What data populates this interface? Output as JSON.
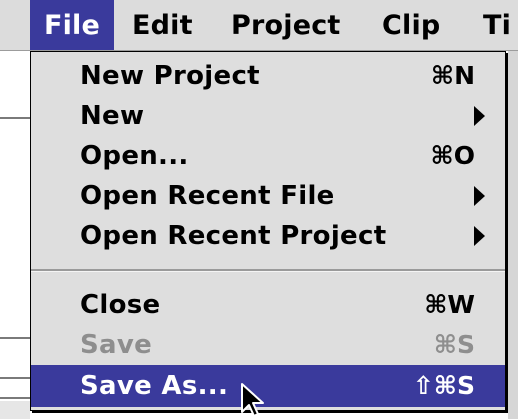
{
  "menubar": {
    "items": [
      {
        "label": "File",
        "open": true
      },
      {
        "label": "Edit"
      },
      {
        "label": "Project"
      },
      {
        "label": "Clip"
      },
      {
        "label": "Ti"
      }
    ]
  },
  "file_menu": {
    "items": [
      {
        "label": "New Project",
        "shortcut": "⌘N"
      },
      {
        "label": "New",
        "submenu": true,
        "icon": "submenu-arrow-icon"
      },
      {
        "label": "Open...",
        "shortcut": "⌘O"
      },
      {
        "label": "Open Recent File",
        "submenu": true,
        "icon": "submenu-arrow-icon"
      },
      {
        "label": "Open Recent Project",
        "submenu": true,
        "icon": "submenu-arrow-icon"
      },
      {
        "label": "Close",
        "shortcut": "⌘W"
      },
      {
        "label": "Save",
        "shortcut": "⌘S",
        "enabled": false
      },
      {
        "label": "Save As...",
        "shortcut": "⇧⌘S",
        "highlighted": true
      }
    ]
  },
  "colors": {
    "menu_background": "#dedede",
    "highlight": "#3a3a9c",
    "disabled_text": "#8e8e8e",
    "menubar_background": "#dcdcdc"
  },
  "cursor": {
    "icon": "arrow-pointer-icon"
  }
}
